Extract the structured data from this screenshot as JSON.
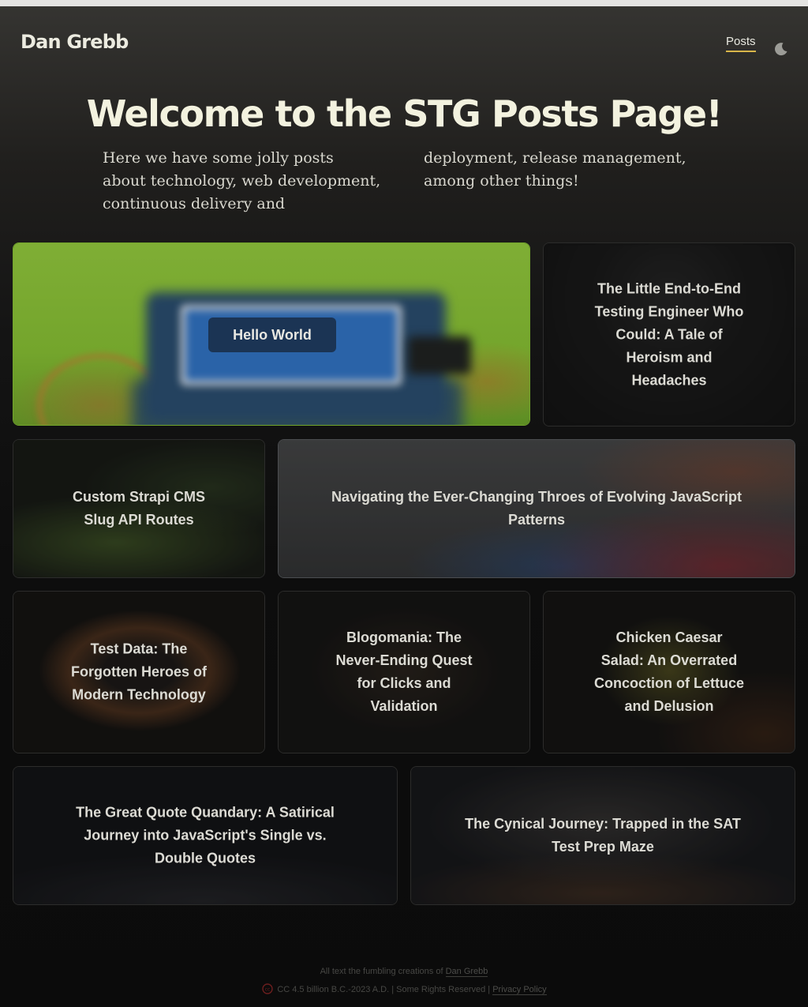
{
  "header": {
    "site_name": "Dan Grebb",
    "nav": {
      "posts_label": "Posts"
    },
    "theme_toggle_icon": "moon-icon",
    "accent_color": "#d9b64a"
  },
  "hero": {
    "title": "Welcome to the STG Posts Page!",
    "intro": "Here we have some jolly posts about technology, web development, continuous delivery and deployment, release management, among other things!"
  },
  "posts": [
    {
      "title": "Hello World"
    },
    {
      "title": "The Little End-to-End Testing Engineer Who Could: A Tale of Heroism and Headaches"
    },
    {
      "title": "Custom Strapi CMS Slug API Routes"
    },
    {
      "title": "Navigating the Ever-Changing Throes of Evolving JavaScript Patterns"
    },
    {
      "title": "Test Data: The Forgotten Heroes of Modern Technology"
    },
    {
      "title": "Blogomania: The Never-Ending Quest for Clicks and Validation"
    },
    {
      "title": "Chicken Caesar Salad: An Overrated Concoction of Lettuce and Delusion"
    },
    {
      "title": "The Great Quote Quandary: A Satirical Journey into JavaScript's Single vs. Double Quotes"
    },
    {
      "title": "The Cynical Journey: Trapped in the SAT Test Prep Maze"
    }
  ],
  "footer": {
    "credit_prefix": "All text the fumbling creations of",
    "credit_name": "Dan Grebb",
    "license_icon": "creative-commons-icon",
    "license_text": "CC 4.5 billion B.C.-2023 A.D. | Some Rights Reserved |",
    "privacy_label": "Privacy Policy"
  }
}
